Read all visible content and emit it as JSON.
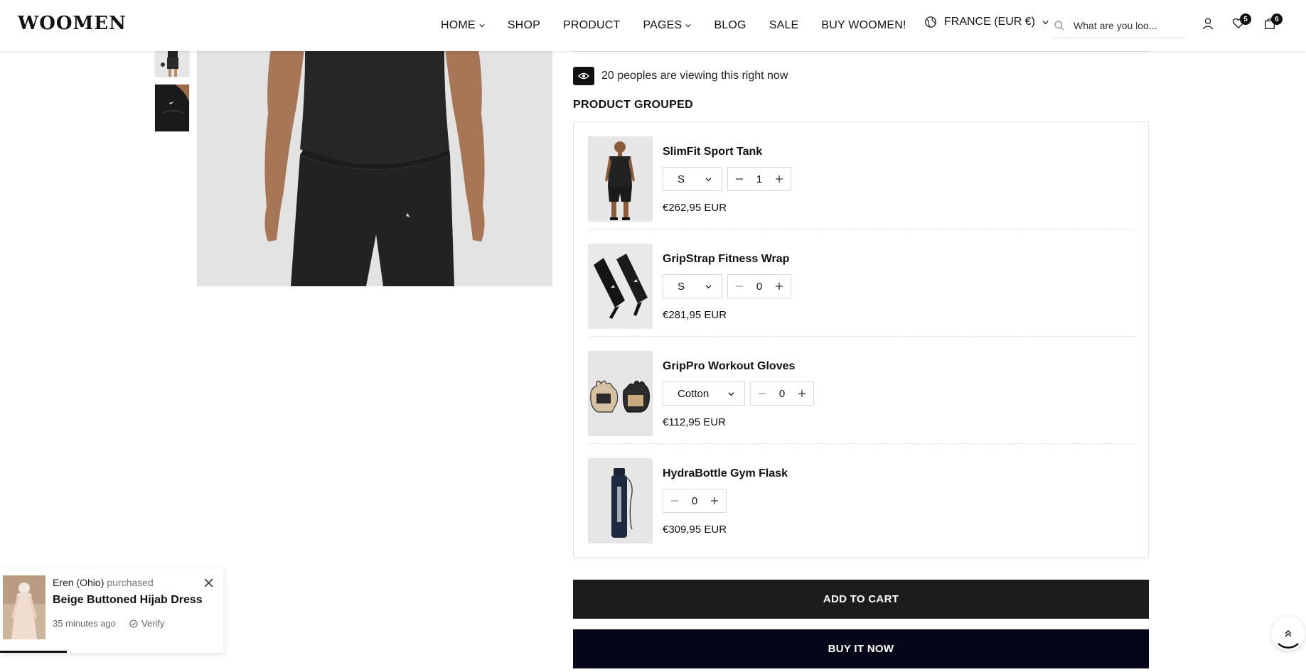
{
  "header": {
    "logo": "WOOMEN",
    "nav": [
      {
        "label": "HOME",
        "has_dropdown": true
      },
      {
        "label": "SHOP",
        "has_dropdown": false
      },
      {
        "label": "PRODUCT",
        "has_dropdown": false
      },
      {
        "label": "PAGES",
        "has_dropdown": true
      },
      {
        "label": "BLOG",
        "has_dropdown": false
      },
      {
        "label": "SALE",
        "has_dropdown": false
      },
      {
        "label": "BUY WOOMEN!",
        "has_dropdown": false
      }
    ],
    "country": "FRANCE (EUR €)",
    "search_placeholder": "What are you loo...",
    "wishlist_count": "5",
    "cart_count": "6",
    "icons": [
      "globe-icon",
      "search-icon",
      "user-icon",
      "heart-icon",
      "bag-icon"
    ]
  },
  "product": {
    "viewing_text": "20 peoples are viewing this right now",
    "group_title": "PRODUCT GROUPED",
    "items": [
      {
        "name": "SlimFit Sport Tank",
        "variant": "S",
        "has_variant": true,
        "qty": "1",
        "price": "€262,95 EUR"
      },
      {
        "name": "GripStrap Fitness Wrap",
        "variant": "S",
        "has_variant": true,
        "qty": "0",
        "price": "€281,95 EUR"
      },
      {
        "name": "GripPro Workout Gloves",
        "variant": "Cotton",
        "has_variant": true,
        "qty": "0",
        "price": "€112,95 EUR"
      },
      {
        "name": "HydraBottle Gym Flask",
        "variant": "",
        "has_variant": false,
        "qty": "0",
        "price": "€309,95 EUR"
      }
    ],
    "add_to_cart": "ADD TO CART",
    "buy_now": "BUY IT NOW"
  },
  "popup": {
    "buyer": "Eren (Ohio)",
    "action": "purchased",
    "product": "Beige Buttoned Hijab Dress",
    "time": "35 minutes ago",
    "verify": "Verify",
    "progress": 0.3
  },
  "colors": {
    "primary_button": "#1c1c1c",
    "buy_button": "#050618",
    "badge": "#111111"
  }
}
